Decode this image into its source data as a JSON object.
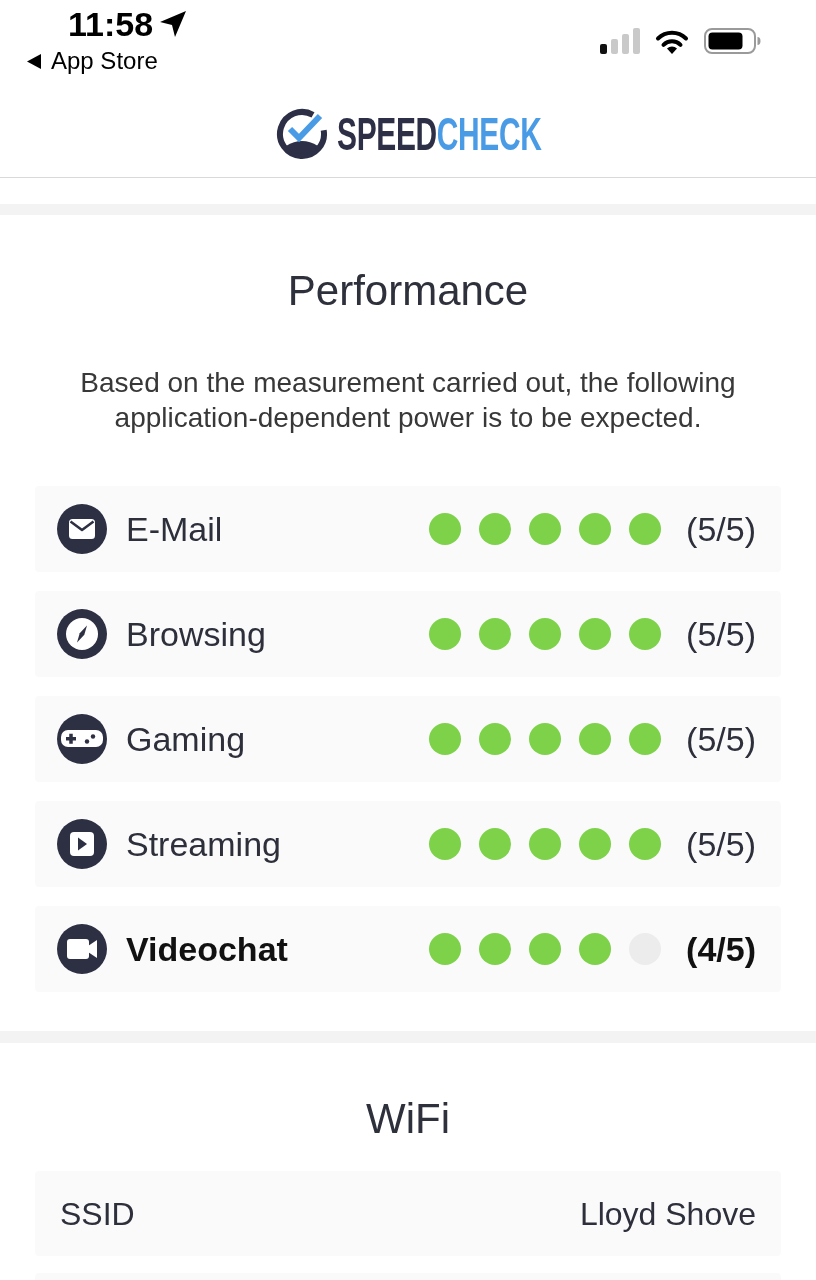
{
  "status_bar": {
    "time": "11:58",
    "back_label": "App Store"
  },
  "header": {
    "logo": [
      {
        "text": "SPEED",
        "color": "#2d2f47"
      },
      {
        "text": "CHECK",
        "color": "#4a9be6"
      }
    ]
  },
  "performance": {
    "title": "Performance",
    "description": "Based on the measurement carried out, the following application-dependent power is to be expected.",
    "items": [
      {
        "label": "E-Mail",
        "stars": 5,
        "score": "(5/5)",
        "emphasized": false
      },
      {
        "label": "Browsing",
        "stars": 5,
        "score": "(5/5)",
        "emphasized": false
      },
      {
        "label": "Gaming",
        "stars": 5,
        "score": "(5/5)",
        "emphasized": false
      },
      {
        "label": "Streaming",
        "stars": 5,
        "score": "(5/5)",
        "emphasized": false
      },
      {
        "label": "Videochat",
        "stars": 4,
        "score": "(4/5)",
        "emphasized": true
      }
    ]
  },
  "wifi": {
    "title": "WiFi",
    "rows": [
      {
        "label": "SSID",
        "value": "Lloyd Shove"
      }
    ]
  }
}
